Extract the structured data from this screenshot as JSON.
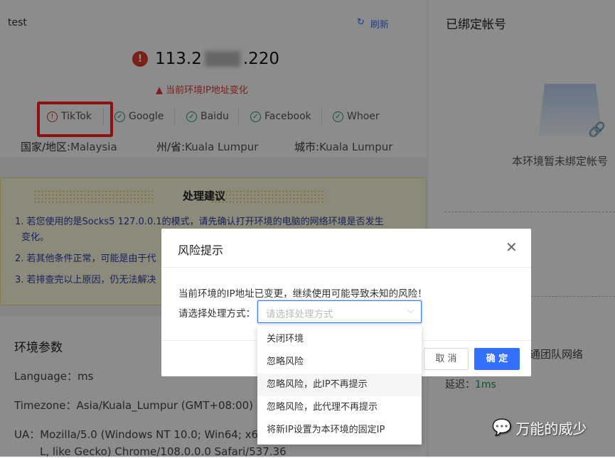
{
  "env_card": {
    "name": "test",
    "refresh": "刷新",
    "ip_prefix": "113.2",
    "ip_suffix": ".220",
    "warning": "当前环境IP地址变化",
    "services": [
      {
        "label": "TikTok",
        "status": "error"
      },
      {
        "label": "Google",
        "status": "ok"
      },
      {
        "label": "Baidu",
        "status": "ok"
      },
      {
        "label": "Facebook",
        "status": "ok"
      },
      {
        "label": "Whoer",
        "status": "ok"
      }
    ],
    "country_label": "国家/地区:",
    "country": "Malaysia",
    "state_label": "州/省:",
    "state": "Kuala Lumpur",
    "city_label": "城市:",
    "city": "Kuala Lumpur"
  },
  "advice": {
    "title": "处理建议",
    "items": [
      "1. 若您使用的是Socks5 127.0.0.1的模式，请先确认打开环境的电脑的网络环境是否发生",
      "变化。",
      "2. 若其他条件正常，可能是由于代",
      "3. 若排查完以上原因，仍无法解决"
    ]
  },
  "params": {
    "title": "环境参数",
    "language": "Language：ms",
    "timezone": "Timezone：Asia/Kuala_Lumpur (GMT+08:00) 202",
    "ua1": "UA：Mozilla/5.0 (Windows NT 10.0; Win64; x64) A",
    "ua2": "L, like Gecko) Chrome/108.0.0.0 Safari/537.36"
  },
  "right": {
    "title": "已绑定帐号",
    "empty": "本环境暂未绑定帐号",
    "network": "通团队网络",
    "latency_label": "延迟：",
    "latency": "1ms"
  },
  "dialog": {
    "title": "风险提示",
    "message": "当前环境的IP地址已变更，继续使用可能导致未知的风险！",
    "select_label": "请选择处理方式：",
    "select_placeholder": "请选择处理方式",
    "cancel": "取 消",
    "confirm": "确 定",
    "options": [
      "关闭环境",
      "忽略风险",
      "忽略风险，此IP不再提示",
      "忽略风险，此代理不再提示",
      "将新IP设置为本环境的固定IP"
    ]
  },
  "watermark": "万能的威少",
  "colors": {
    "primary": "#3370ff",
    "danger": "#d33",
    "success": "#1a9a5a"
  }
}
